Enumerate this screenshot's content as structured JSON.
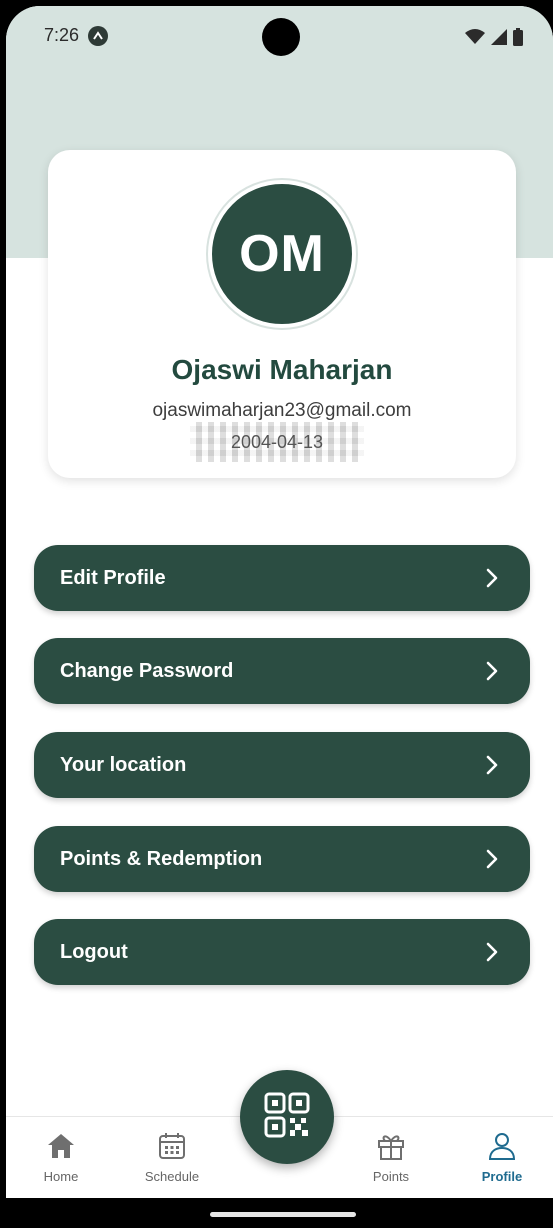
{
  "status_bar": {
    "time": "7:26"
  },
  "profile": {
    "initials": "OM",
    "name": "Ojaswi Maharjan",
    "email": "ojaswimaharjan23@gmail.com",
    "dob": "2004-04-13"
  },
  "menu": [
    {
      "label": "Edit Profile"
    },
    {
      "label": "Change Password"
    },
    {
      "label": "Your location"
    },
    {
      "label": "Points & Redemption"
    },
    {
      "label": "Logout"
    }
  ],
  "bottom_nav": {
    "items": [
      {
        "label": "Home",
        "icon": "home-icon"
      },
      {
        "label": "Schedule",
        "icon": "calendar-icon"
      },
      {
        "label": "Points",
        "icon": "gift-icon"
      },
      {
        "label": "Profile",
        "icon": "user-icon",
        "active": true
      }
    ],
    "fab_icon": "qr-code-icon"
  },
  "colors": {
    "primary": "#2b4d42",
    "header_bg": "#d6e3df",
    "active_nav": "#1f6b8f"
  }
}
